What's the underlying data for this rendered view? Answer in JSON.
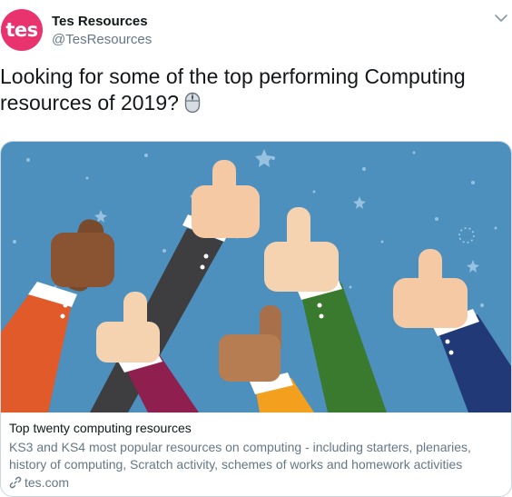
{
  "tweet": {
    "author": {
      "avatar_text": "tes",
      "name": "Tes Resources",
      "handle": "@TesResources"
    },
    "text": "Looking for some of the top performing Computing resources of 2019?",
    "emoji_icon": "computer-mouse-icon",
    "menu_icon": "chevron-down-icon"
  },
  "card": {
    "image_subject": "thumbs-up-hands-illustration",
    "title": "Top twenty computing resources",
    "description": "KS3 and KS4 most popular resources on computing - including starters, plenaries, history of computing, Scratch activity, schemes of works and homework activities",
    "domain": "tes.com",
    "link_icon": "link-icon"
  },
  "colors": {
    "brand_pink": "#e8336e",
    "image_background": "#4d8fbd",
    "secondary_text": "#657786"
  }
}
